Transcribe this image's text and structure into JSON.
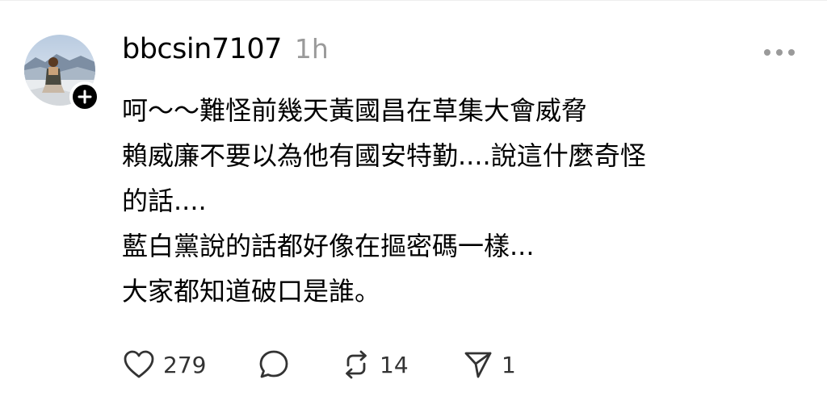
{
  "post": {
    "username": "bbcsin7107",
    "time": "1h",
    "lines": [
      "呵～～難怪前幾天黃國昌￼在￼草集大會威脅",
      "賴威廉不要以為他有國安特勤....￼說這什麼奇怪",
      "的話....",
      "藍白黨說的話都好像在摳密碼一樣...",
      "￼大家都知道破口是誰。"
    ]
  },
  "actions": {
    "likes": "279",
    "reposts": "14",
    "shares": "1"
  },
  "icons": {
    "follow": "plus-icon",
    "more": "more-dots-icon",
    "like": "heart-icon",
    "reply": "comment-bubble-icon",
    "repost": "repost-arrows-icon",
    "share": "send-icon"
  },
  "colors": {
    "text": "#000000",
    "muted": "#9a9a9a",
    "icon": "#333333"
  }
}
